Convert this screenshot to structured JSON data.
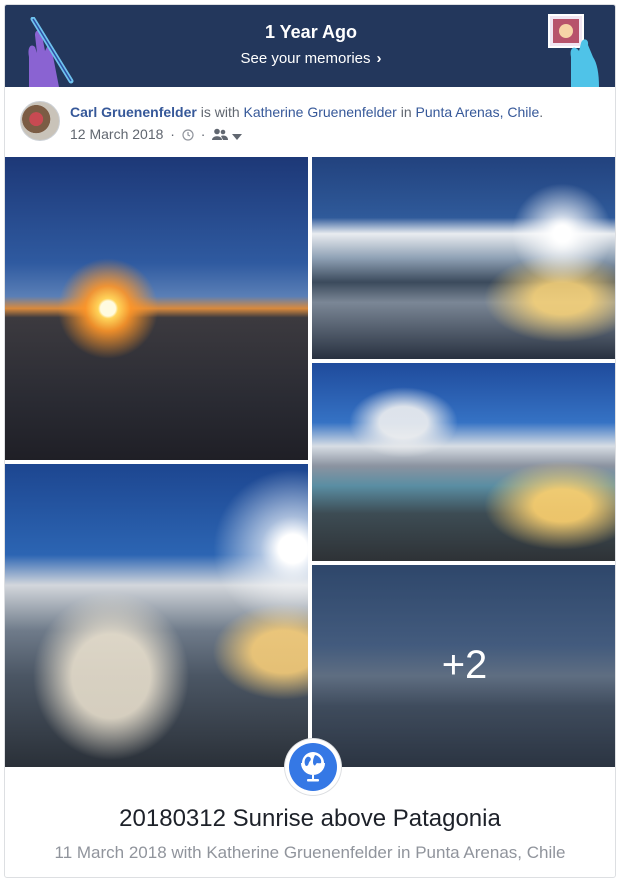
{
  "banner": {
    "title": "1 Year Ago",
    "link_label": "See your memories",
    "background": "#23375c"
  },
  "post": {
    "author": "Carl Gruenenfelder",
    "with_text": "is with",
    "tagged": "Katherine Gruenenfelder",
    "in_text": "in",
    "location": "Punta Arenas, Chile",
    "date": "12 March 2018",
    "link_color": "#365899"
  },
  "photos": {
    "more_count": "+2"
  },
  "album": {
    "title": "20180312 Sunrise above Patagonia",
    "subtitle": "11 March 2018 with Katherine Gruenenfelder in Punta Arenas, Chile",
    "badge_color": "#3578e5"
  }
}
